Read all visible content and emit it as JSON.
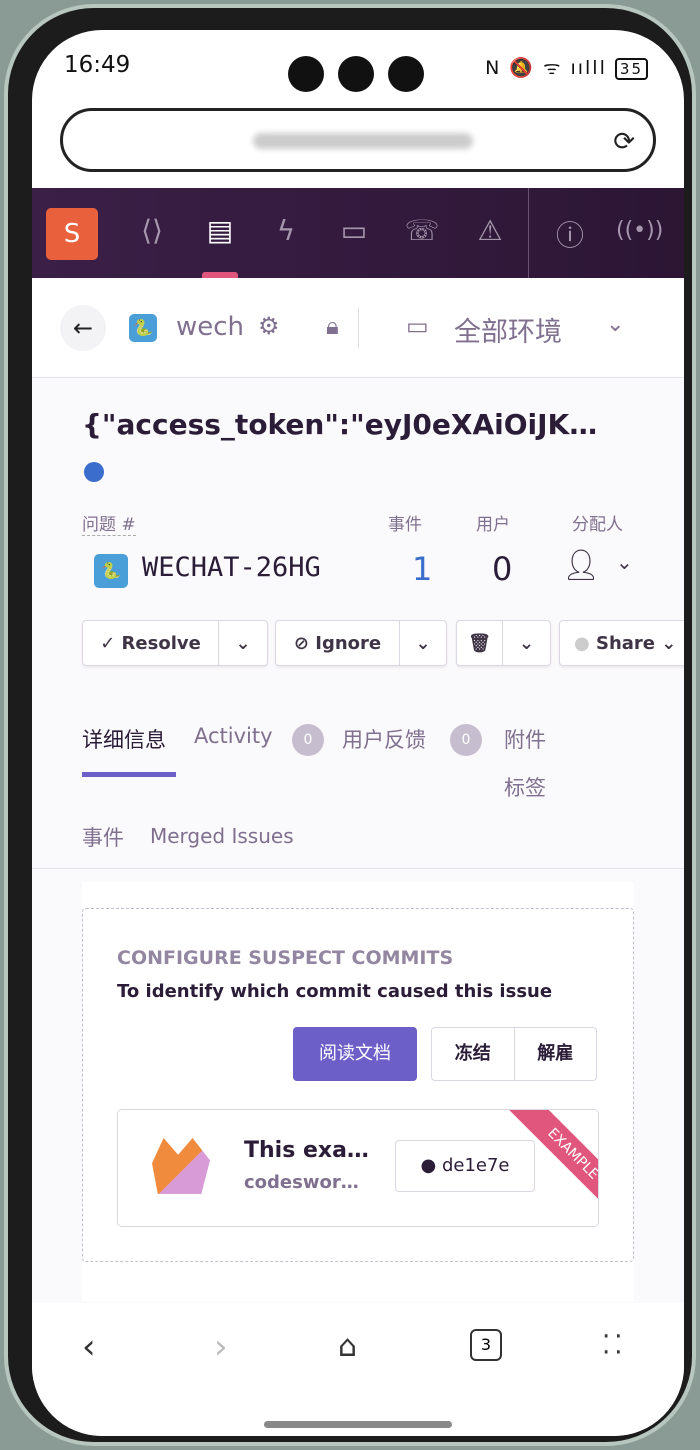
{
  "status_bar": {
    "time": "16:49",
    "battery": "35"
  },
  "browser": {
    "reload_icon": "reload-icon"
  },
  "nav": {
    "logo": "S",
    "colors": {
      "bg": "#2f1937",
      "active_indicator": "#e1567c",
      "logo": "#e8613c"
    }
  },
  "header": {
    "project": "wech",
    "environment": "全部环境"
  },
  "issue": {
    "title": "{\"access_token\":\"eyJ0eXAiOiJK…",
    "id_label": "问题 #",
    "id": "WECHAT-26HG",
    "events_label": "事件",
    "events": "1",
    "users_label": "用户",
    "users": "0",
    "assignee_label": "分配人"
  },
  "actions": {
    "resolve": "Resolve",
    "ignore": "Ignore",
    "share": "Share"
  },
  "tabs": [
    {
      "label": "详细信息",
      "active": true
    },
    {
      "label": "Activity",
      "count": "0"
    },
    {
      "label": "用户反馈",
      "count": "0"
    },
    {
      "label": "附件"
    },
    {
      "label": "标签"
    },
    {
      "label": "事件"
    },
    {
      "label": "Merged Issues"
    }
  ],
  "suspect": {
    "heading": "CONFIGURE SUSPECT COMMITS",
    "subheading": "To identify which commit caused this issue",
    "read_docs": "阅读文档",
    "snooze": "冻结",
    "dismiss": "解雇",
    "example_title": "This exa…",
    "example_author": "codeswor…",
    "commit": "de1e7e",
    "ribbon": "EXAMPLE",
    "accent": "#6c5fc7"
  },
  "bottom_nav": {
    "tabs_count": "3"
  }
}
